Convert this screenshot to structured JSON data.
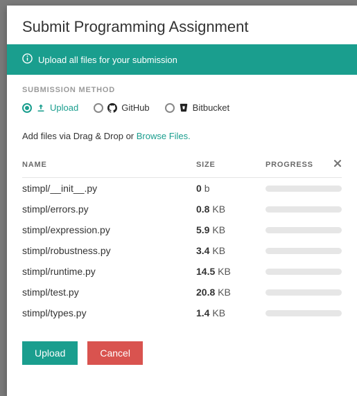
{
  "title": "Submit Programming Assignment",
  "banner": {
    "text": "Upload all files for your submission"
  },
  "section_label": "SUBMISSION METHOD",
  "methods": [
    {
      "label": "Upload",
      "selected": true
    },
    {
      "label": "GitHub",
      "selected": false
    },
    {
      "label": "Bitbucket",
      "selected": false
    }
  ],
  "dropzone": {
    "prefix": "Add files via Drag & Drop or ",
    "link": "Browse Files."
  },
  "columns": {
    "name": "NAME",
    "size": "SIZE",
    "progress": "PROGRESS"
  },
  "files": [
    {
      "name": "stimpl/__init__.py",
      "size_num": "0",
      "size_unit": "b"
    },
    {
      "name": "stimpl/errors.py",
      "size_num": "0.8",
      "size_unit": "KB"
    },
    {
      "name": "stimpl/expression.py",
      "size_num": "5.9",
      "size_unit": "KB"
    },
    {
      "name": "stimpl/robustness.py",
      "size_num": "3.4",
      "size_unit": "KB"
    },
    {
      "name": "stimpl/runtime.py",
      "size_num": "14.5",
      "size_unit": "KB"
    },
    {
      "name": "stimpl/test.py",
      "size_num": "20.8",
      "size_unit": "KB"
    },
    {
      "name": "stimpl/types.py",
      "size_num": "1.4",
      "size_unit": "KB"
    }
  ],
  "buttons": {
    "upload": "Upload",
    "cancel": "Cancel"
  }
}
